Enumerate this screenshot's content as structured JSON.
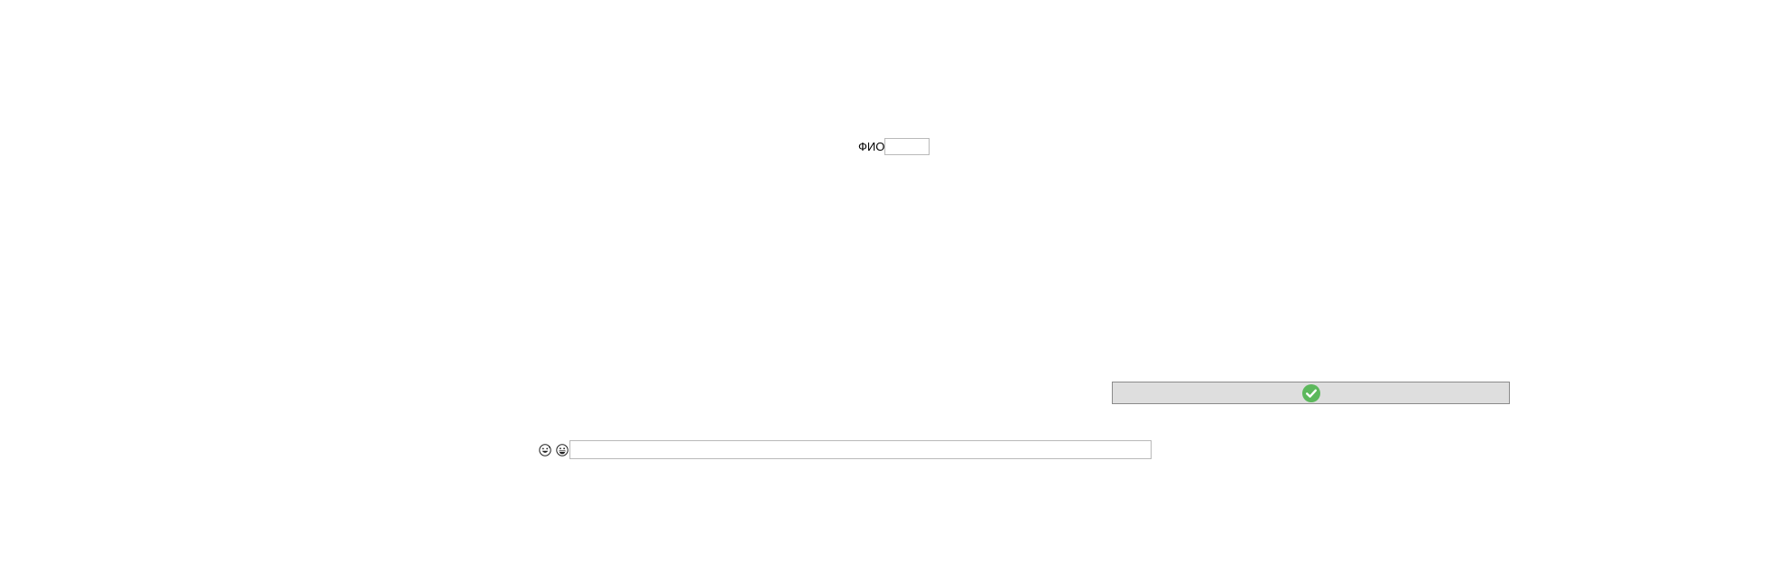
{
  "fio": {
    "label": "ФИО",
    "value": ""
  },
  "confirm": {
    "icon": "check-circle-icon",
    "color": "#5cb85c"
  },
  "emoji_row": {
    "icons": [
      "grinning-sweat-face-icon",
      "grinning-face-icon"
    ],
    "input_value": ""
  }
}
